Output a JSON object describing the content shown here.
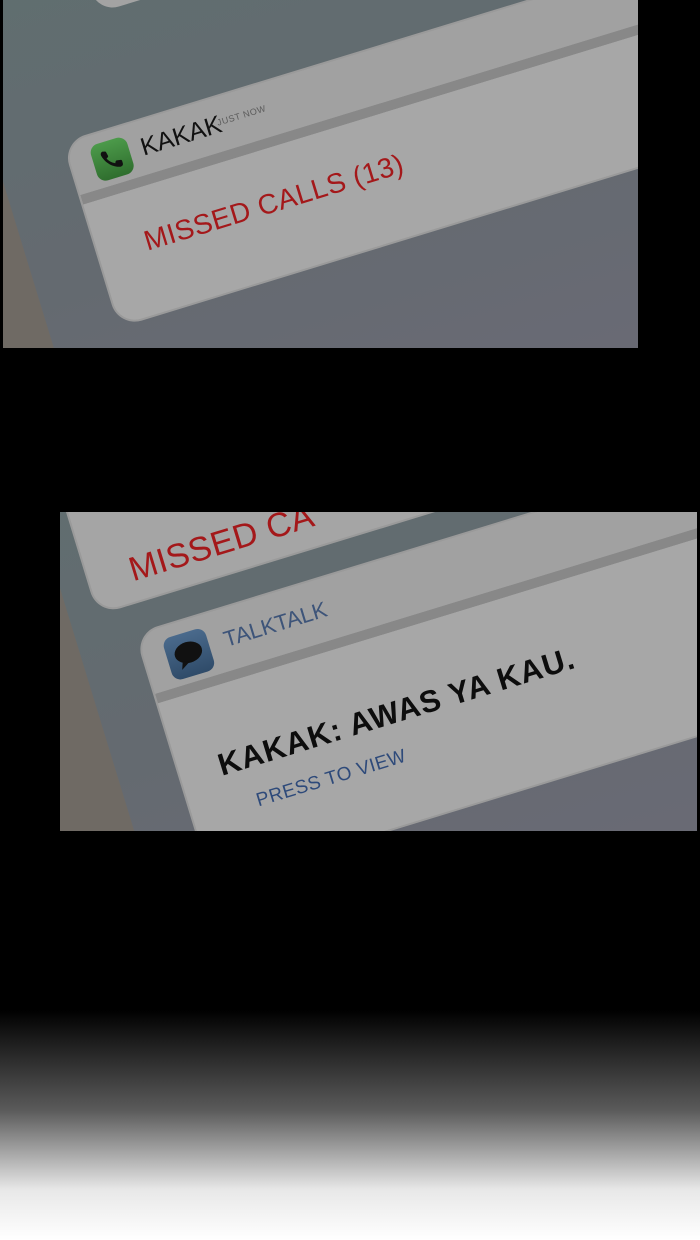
{
  "panels": {
    "top": {
      "notification": {
        "app_name": "KAKAK",
        "time": "JUST NOW",
        "icon": "phone-icon",
        "body": "MISSED CALLS (13)"
      }
    },
    "bottom": {
      "previous_notification_partial": "MISSED CA",
      "notification": {
        "app_name": "TALKTALK",
        "icon": "chat-bubble-icon",
        "message": "KAKAK: AWAS YA KAU.",
        "action": "PRESS TO VIEW"
      }
    }
  },
  "colors": {
    "missed_calls": "#a4181a",
    "message_text": "#0d0d0d",
    "talktalk_label": "#3d5479",
    "press_to_view": "#2e4a7a",
    "phone_icon": "#3f8a3d",
    "chat_icon": "#3c5a7c"
  }
}
